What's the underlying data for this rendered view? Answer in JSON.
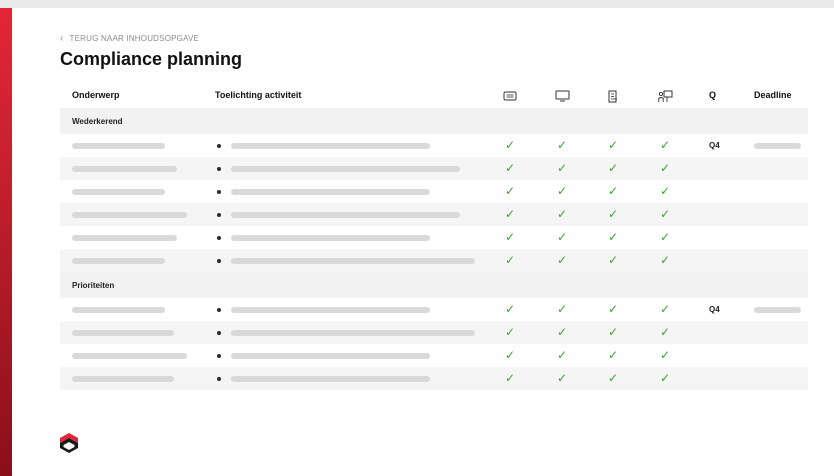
{
  "nav": {
    "back_label": "TERUG NAAR INHOUDSOPGAVE"
  },
  "page": {
    "title": "Compliance planning"
  },
  "table": {
    "headers": {
      "onderwerp": "Onderwerp",
      "toelichting": "Toelichting activiteit",
      "q": "Q",
      "deadline": "Deadline"
    },
    "icon_columns": [
      "chat-icon",
      "monitor-icon",
      "document-icon",
      "people-board-icon"
    ],
    "sections": [
      {
        "label": "Wederkerend",
        "rows": [
          {
            "q": "Q4",
            "deadline_placeholder": true,
            "checks": [
              true,
              true,
              true,
              true
            ]
          },
          {
            "q": "",
            "deadline_placeholder": false,
            "checks": [
              true,
              true,
              true,
              true
            ]
          },
          {
            "q": "",
            "deadline_placeholder": false,
            "checks": [
              true,
              true,
              true,
              true
            ]
          },
          {
            "q": "",
            "deadline_placeholder": false,
            "checks": [
              true,
              true,
              true,
              true
            ]
          },
          {
            "q": "",
            "deadline_placeholder": false,
            "checks": [
              true,
              true,
              true,
              true
            ]
          },
          {
            "q": "",
            "deadline_placeholder": false,
            "checks": [
              true,
              true,
              true,
              true
            ]
          }
        ]
      },
      {
        "label": "Prioriteiten",
        "rows": [
          {
            "q": "Q4",
            "deadline_placeholder": true,
            "checks": [
              true,
              true,
              true,
              true
            ]
          },
          {
            "q": "",
            "deadline_placeholder": false,
            "checks": [
              true,
              true,
              true,
              true
            ]
          },
          {
            "q": "",
            "deadline_placeholder": false,
            "checks": [
              true,
              true,
              true,
              true
            ]
          },
          {
            "q": "",
            "deadline_placeholder": false,
            "checks": [
              true,
              true,
              true,
              true
            ]
          }
        ]
      }
    ]
  },
  "colors": {
    "accent": "#e32636",
    "check": "#3aa335",
    "placeholder": "#d9d9d9",
    "section_bg": "#f2f2f2"
  }
}
